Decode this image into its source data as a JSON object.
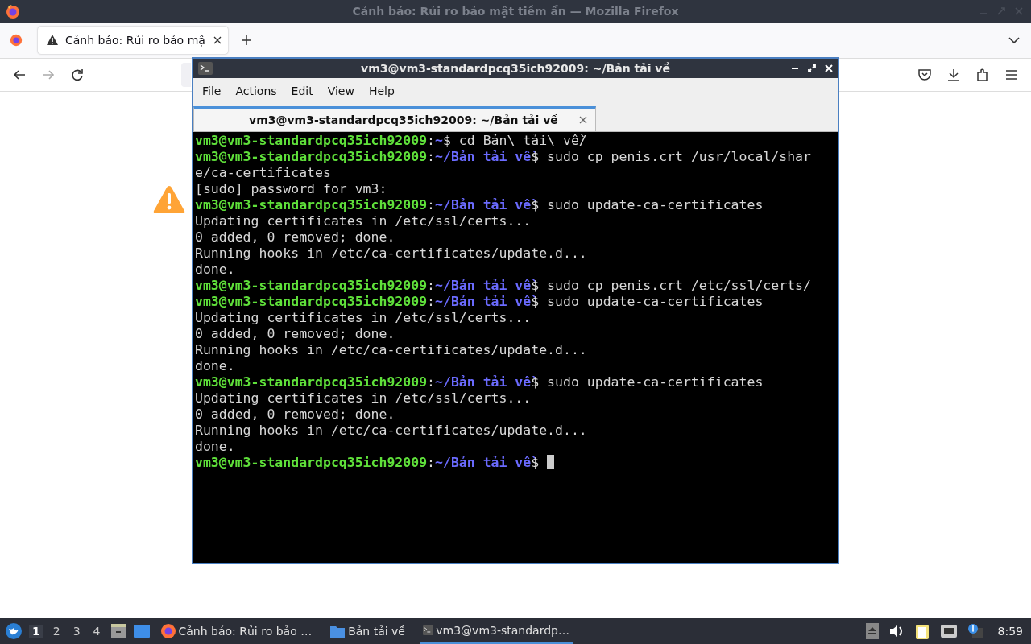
{
  "firefox": {
    "title": "Cảnh báo: Rủi ro bảo mật tiềm ẩn — Mozilla Firefox",
    "tab": {
      "title": "Cảnh báo: Rủi ro bảo mậ",
      "selected": true
    }
  },
  "terminal": {
    "title": "vm3@vm3-standardpcq35ich92009: ~/Bản tải về",
    "menu": [
      "File",
      "Actions",
      "Edit",
      "View",
      "Help"
    ],
    "tab": {
      "title": "vm3@vm3-standardpcq35ich92009: ~/Bản tải về",
      "selected": true
    },
    "lines": [
      {
        "kind": "prompt",
        "user": "vm3@vm3-standardpcq35ich92009",
        "colon": ":",
        "path": "~",
        "sigil": "$",
        "command": "cd Bản\\ tải\\ về/",
        "cursor": false
      },
      {
        "kind": "prompt",
        "user": "vm3@vm3-standardpcq35ich92009",
        "colon": ":",
        "path": "~/Bản tải về",
        "sigil": "$",
        "command": "sudo cp penis.crt /usr/local/share/ca-certificates",
        "cursor": false
      },
      {
        "kind": "output",
        "text": "[sudo] password for vm3:"
      },
      {
        "kind": "prompt",
        "user": "vm3@vm3-standardpcq35ich92009",
        "colon": ":",
        "path": "~/Bản tải về",
        "sigil": "$",
        "command": "sudo update-ca-certificates",
        "cursor": false
      },
      {
        "kind": "output",
        "text": "Updating certificates in /etc/ssl/certs..."
      },
      {
        "kind": "output",
        "text": "0 added, 0 removed; done."
      },
      {
        "kind": "output",
        "text": "Running hooks in /etc/ca-certificates/update.d..."
      },
      {
        "kind": "output",
        "text": "done."
      },
      {
        "kind": "prompt",
        "user": "vm3@vm3-standardpcq35ich92009",
        "colon": ":",
        "path": "~/Bản tải về",
        "sigil": "$",
        "command": "sudo cp penis.crt /etc/ssl/certs/",
        "cursor": false
      },
      {
        "kind": "prompt",
        "user": "vm3@vm3-standardpcq35ich92009",
        "colon": ":",
        "path": "~/Bản tải về",
        "sigil": "$",
        "command": "sudo update-ca-certificates",
        "cursor": false
      },
      {
        "kind": "output",
        "text": "Updating certificates in /etc/ssl/certs..."
      },
      {
        "kind": "output",
        "text": "0 added, 0 removed; done."
      },
      {
        "kind": "output",
        "text": "Running hooks in /etc/ca-certificates/update.d..."
      },
      {
        "kind": "output",
        "text": "done."
      },
      {
        "kind": "prompt",
        "user": "vm3@vm3-standardpcq35ich92009",
        "colon": ":",
        "path": "~/Bản tải về",
        "sigil": "$",
        "command": "sudo update-ca-certificates",
        "cursor": false
      },
      {
        "kind": "output",
        "text": "Updating certificates in /etc/ssl/certs..."
      },
      {
        "kind": "output",
        "text": "0 added, 0 removed; done."
      },
      {
        "kind": "output",
        "text": "Running hooks in /etc/ca-certificates/update.d..."
      },
      {
        "kind": "output",
        "text": "done."
      },
      {
        "kind": "prompt",
        "user": "vm3@vm3-standardpcq35ich92009",
        "colon": ":",
        "path": "~/Bản tải về",
        "sigil": "$",
        "cursor": true
      }
    ]
  },
  "taskbar": {
    "workspaces": [
      {
        "label": "1",
        "selected": true
      },
      {
        "label": "2",
        "selected": false
      },
      {
        "label": "3",
        "selected": false
      },
      {
        "label": "4",
        "selected": false
      }
    ],
    "tasks": [
      {
        "kind": "browser",
        "label": "Cảnh báo: Rủi ro bảo …",
        "selected": false
      },
      {
        "kind": "folder",
        "label": "Bản tải về",
        "selected": false
      },
      {
        "kind": "terminal",
        "label": "vm3@vm3-standardp…",
        "selected": true
      }
    ],
    "clock": "8:59"
  }
}
